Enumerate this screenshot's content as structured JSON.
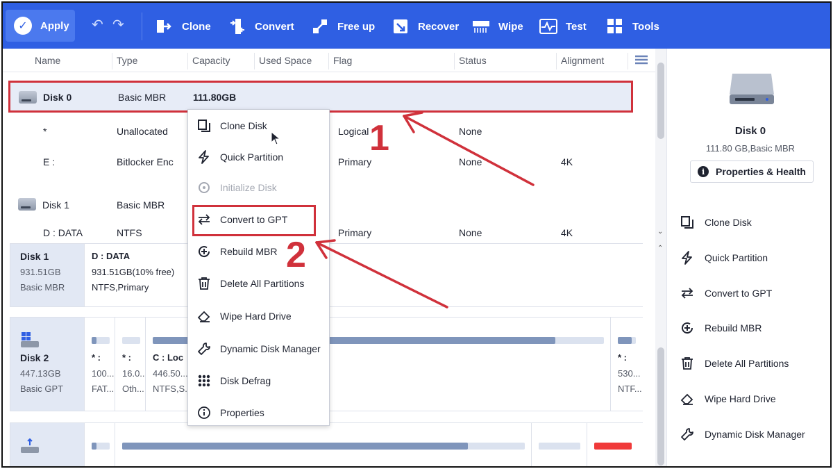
{
  "toolbar": {
    "apply": "Apply",
    "items": [
      {
        "label": "Clone",
        "icon": "clone-icon"
      },
      {
        "label": "Convert",
        "icon": "convert-icon"
      },
      {
        "label": "Free up",
        "icon": "free-up-icon"
      },
      {
        "label": "Recover",
        "icon": "recover-icon"
      },
      {
        "label": "Wipe",
        "icon": "wipe-icon"
      },
      {
        "label": "Test",
        "icon": "test-icon"
      },
      {
        "label": "Tools",
        "icon": "tools-icon"
      }
    ]
  },
  "columns": [
    "Name",
    "Type",
    "Capacity",
    "Used Space",
    "Flag",
    "Status",
    "Alignment"
  ],
  "disk_rows": [
    {
      "name": "Disk 0",
      "type": "Basic MBR",
      "capacity": "111.80GB",
      "selected": true
    },
    {
      "name": "*",
      "type": "Unallocated",
      "flag": "Logical",
      "status": "None"
    },
    {
      "name": "E :",
      "type": "Bitlocker Enc",
      "flag": "Primary",
      "status": "None",
      "alignment": "4K"
    },
    {
      "name": "Disk 1",
      "type": "Basic MBR"
    },
    {
      "name": "D : DATA",
      "type": "NTFS",
      "flag": "Primary",
      "status": "None",
      "alignment": "4K"
    }
  ],
  "map": {
    "disk1": {
      "name": "Disk 1",
      "size": "931.51GB",
      "type": "Basic MBR",
      "partition": {
        "label": "D : DATA",
        "detail": "931.51GB(10% free)",
        "fs": "NTFS,Primary"
      }
    },
    "disk2": {
      "name": "Disk 2",
      "size": "447.13GB",
      "type": "Basic GPT",
      "partitions": [
        {
          "label": "* :",
          "size": "100...",
          "fs": "FAT..."
        },
        {
          "label": "* :",
          "size": "16.0...",
          "fs": "Oth..."
        },
        {
          "label": "C : Loc",
          "size": "446.50...",
          "fs": "NTFS,S..."
        },
        {
          "label": "* :",
          "size": "530...",
          "fs": "NTF..."
        }
      ]
    }
  },
  "context_menu": {
    "items": [
      {
        "label": "Clone Disk",
        "icon": "clone-disk-icon",
        "disabled": false
      },
      {
        "label": "Quick Partition",
        "icon": "lightning-icon",
        "disabled": false
      },
      {
        "label": "Initialize Disk",
        "icon": "initialize-icon",
        "disabled": true
      },
      {
        "label": "Convert to GPT",
        "icon": "convert-arrows-icon",
        "disabled": false
      },
      {
        "label": "Rebuild MBR",
        "icon": "rebuild-icon",
        "disabled": false
      },
      {
        "label": "Delete All Partitions",
        "icon": "trash-icon",
        "disabled": false
      },
      {
        "label": "Wipe Hard Drive",
        "icon": "eraser-icon",
        "disabled": false
      },
      {
        "label": "Dynamic Disk Manager",
        "icon": "wrench-icon",
        "disabled": false
      },
      {
        "label": "Disk Defrag",
        "icon": "defrag-icon",
        "disabled": false
      },
      {
        "label": "Properties",
        "icon": "info-icon",
        "disabled": false
      }
    ]
  },
  "right_panel": {
    "title": "Disk 0",
    "subtitle": "111.80 GB,Basic MBR",
    "properties_button": "Properties & Health",
    "actions": [
      {
        "label": "Clone Disk",
        "icon": "clone-disk-icon"
      },
      {
        "label": "Quick Partition",
        "icon": "lightning-icon"
      },
      {
        "label": "Convert to GPT",
        "icon": "convert-arrows-icon"
      },
      {
        "label": "Rebuild MBR",
        "icon": "rebuild-icon"
      },
      {
        "label": "Delete All Partitions",
        "icon": "trash-icon"
      },
      {
        "label": "Wipe Hard Drive",
        "icon": "eraser-icon"
      },
      {
        "label": "Dynamic Disk Manager",
        "icon": "wrench-icon"
      }
    ]
  },
  "annotations": {
    "step1": "1",
    "step2": "2",
    "color": "#d0313b"
  },
  "colors": {
    "toolbar": "#2f5fe3",
    "accent": "#d0313b"
  }
}
